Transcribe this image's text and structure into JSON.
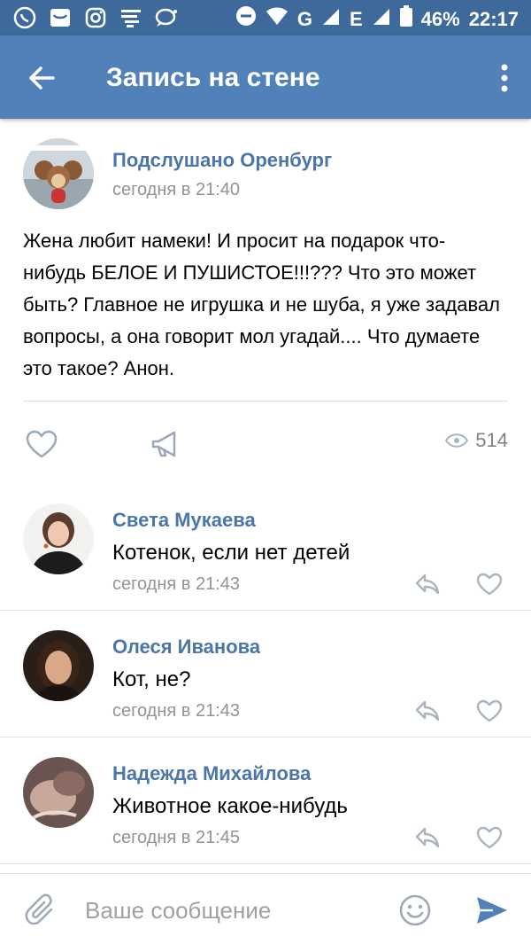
{
  "status_bar": {
    "battery": "46%",
    "time": "22:17",
    "network_1": "G",
    "network_2": "E"
  },
  "header": {
    "title": "Запись на стене"
  },
  "post": {
    "author": "Подслушано Оренбург",
    "time": "сегодня в 21:40",
    "text": "Жена любит намеки! И просит на подарок что-нибудь БЕЛОЕ И ПУШИСТОЕ!!!??? Что это может быть? Главное не игрушка и не шуба, я уже задавал вопросы, а она говорит мол угадай.... Что думаете это такое? Анон.",
    "views": "514"
  },
  "comments": [
    {
      "author": "Света Мукаева",
      "text": "Котенок, если нет детей",
      "time": "сегодня в 21:43"
    },
    {
      "author": "Олеся Иванова",
      "text": "Кот, не?",
      "time": "сегодня в 21:43"
    },
    {
      "author": "Надежда Михайлова",
      "text": "Животное какое-нибудь",
      "time": "сегодня в 21:45"
    }
  ],
  "composer": {
    "placeholder": "Ваше сообщение"
  },
  "colors": {
    "appbar": "#5181b8",
    "statusbar": "#3d6a9a",
    "link": "#4a76a8"
  }
}
